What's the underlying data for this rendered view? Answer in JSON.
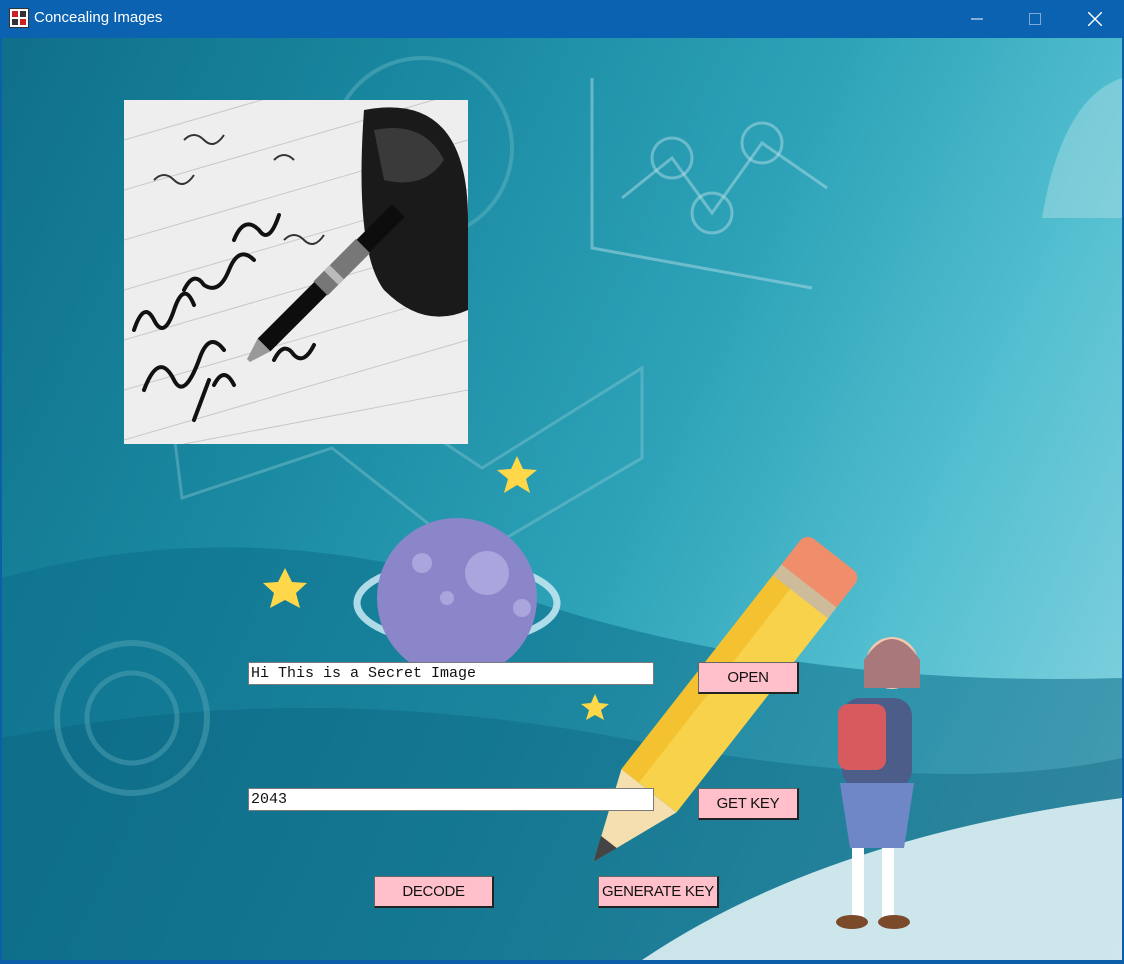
{
  "window": {
    "title": "Concealing Images",
    "minimize_label": "—",
    "maximize_label": "☐",
    "close_label": "✕"
  },
  "form": {
    "message_value": "Hi This is a Secret Image",
    "key_value": "2043"
  },
  "buttons": {
    "open": "OPEN",
    "get_key": "GET KEY",
    "decode": "DECODE",
    "generate_key": "GENERATE KEY"
  },
  "background": {
    "percent_symbol": "%"
  },
  "colors": {
    "titlebar": "#0a62b0",
    "button": "#ffc0cb",
    "accent_teal": "#1a8aa2"
  }
}
